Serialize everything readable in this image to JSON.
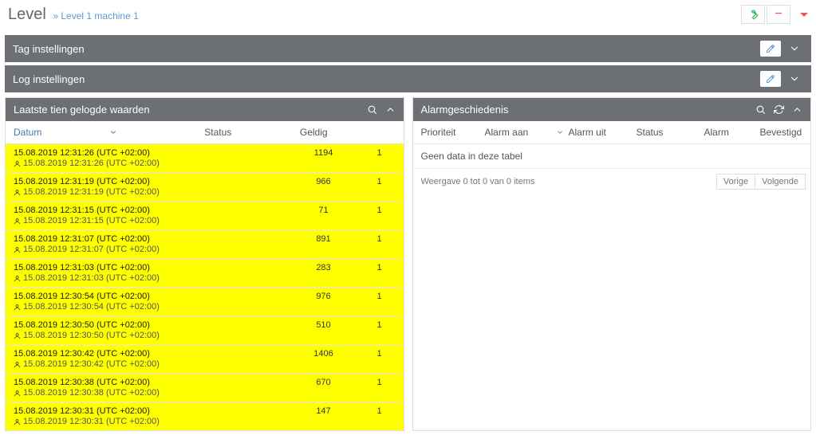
{
  "header": {
    "title": "Level",
    "breadcrumb": "» Level 1 machine 1"
  },
  "bars": {
    "tag": "Tag instellingen",
    "log": "Log instellingen"
  },
  "loggedPanel": {
    "title": "Laatste tien gelogde waarden",
    "columns": {
      "datum": "Datum",
      "status": "Status",
      "geldig": "Geldig"
    },
    "rows": [
      {
        "d1": "15.08.2019 12:31:26 (UTC +02:00)",
        "d2": "15.08.2019 12:31:26 (UTC +02:00)",
        "status": "1194",
        "geldig": "1"
      },
      {
        "d1": "15.08.2019 12:31:19 (UTC +02:00)",
        "d2": "15.08.2019 12:31:19 (UTC +02:00)",
        "status": "966",
        "geldig": "1"
      },
      {
        "d1": "15.08.2019 12:31:15 (UTC +02:00)",
        "d2": "15.08.2019 12:31:15 (UTC +02:00)",
        "status": "71",
        "geldig": "1"
      },
      {
        "d1": "15.08.2019 12:31:07 (UTC +02:00)",
        "d2": "15.08.2019 12:31:07 (UTC +02:00)",
        "status": "891",
        "geldig": "1"
      },
      {
        "d1": "15.08.2019 12:31:03 (UTC +02:00)",
        "d2": "15.08.2019 12:31:03 (UTC +02:00)",
        "status": "283",
        "geldig": "1"
      },
      {
        "d1": "15.08.2019 12:30:54 (UTC +02:00)",
        "d2": "15.08.2019 12:30:54 (UTC +02:00)",
        "status": "976",
        "geldig": "1"
      },
      {
        "d1": "15.08.2019 12:30:50 (UTC +02:00)",
        "d2": "15.08.2019 12:30:50 (UTC +02:00)",
        "status": "510",
        "geldig": "1"
      },
      {
        "d1": "15.08.2019 12:30:42 (UTC +02:00)",
        "d2": "15.08.2019 12:30:42 (UTC +02:00)",
        "status": "1406",
        "geldig": "1"
      },
      {
        "d1": "15.08.2019 12:30:38 (UTC +02:00)",
        "d2": "15.08.2019 12:30:38 (UTC +02:00)",
        "status": "670",
        "geldig": "1"
      },
      {
        "d1": "15.08.2019 12:30:31 (UTC +02:00)",
        "d2": "15.08.2019 12:30:31 (UTC +02:00)",
        "status": "147",
        "geldig": "1"
      }
    ]
  },
  "alarmPanel": {
    "title": "Alarmgeschiedenis",
    "columns": {
      "prio": "Prioriteit",
      "aan": "Alarm aan",
      "uit": "Alarm uit",
      "status": "Status",
      "alarm": "Alarm",
      "bev": "Bevestigd"
    },
    "empty": "Geen data in deze tabel",
    "summary": "Weergave 0 tot 0 van 0 items",
    "prev": "Vorige",
    "next": "Volgende"
  }
}
